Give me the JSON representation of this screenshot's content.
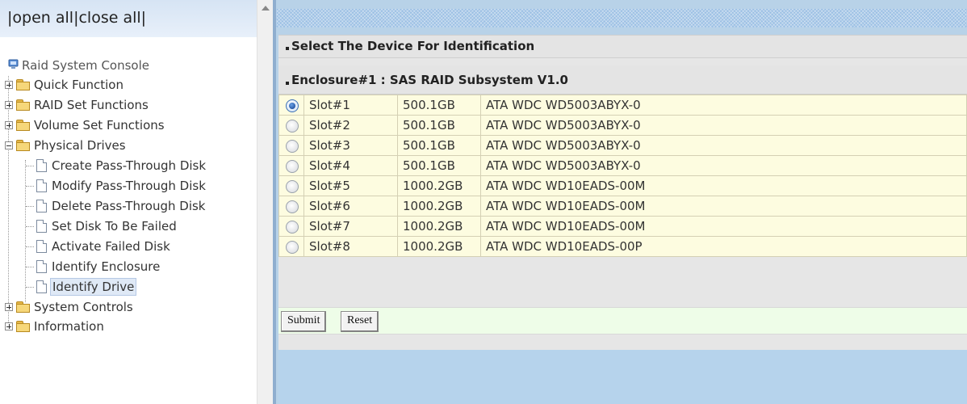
{
  "left": {
    "open_all": "open all",
    "close_all": "close all",
    "sep1": "|",
    "sep2": "|",
    "sep3": "|",
    "root": "Raid System Console",
    "items": [
      {
        "label": "Quick Function",
        "expanded": false
      },
      {
        "label": "RAID Set Functions",
        "expanded": false
      },
      {
        "label": "Volume Set Functions",
        "expanded": false
      },
      {
        "label": "Physical Drives",
        "expanded": true
      },
      {
        "label": "System Controls",
        "expanded": false
      },
      {
        "label": "Information",
        "expanded": false
      }
    ],
    "physical_drives_children": [
      "Create Pass-Through Disk",
      "Modify Pass-Through Disk",
      "Delete Pass-Through Disk",
      "Set Disk To Be Failed",
      "Activate Failed Disk",
      "Identify Enclosure",
      "Identify Drive"
    ],
    "selected_child": "Identify Drive"
  },
  "main": {
    "section_title": "Select The Device For Identification",
    "enclosure_title": "Enclosure#1 : SAS RAID Subsystem V1.0",
    "drives": [
      {
        "slot": "Slot#1",
        "capacity": "500.1GB",
        "model": "ATA WDC WD5003ABYX-0",
        "selected": true
      },
      {
        "slot": "Slot#2",
        "capacity": "500.1GB",
        "model": "ATA WDC WD5003ABYX-0",
        "selected": false
      },
      {
        "slot": "Slot#3",
        "capacity": "500.1GB",
        "model": "ATA WDC WD5003ABYX-0",
        "selected": false
      },
      {
        "slot": "Slot#4",
        "capacity": "500.1GB",
        "model": "ATA WDC WD5003ABYX-0",
        "selected": false
      },
      {
        "slot": "Slot#5",
        "capacity": "1000.2GB",
        "model": "ATA WDC WD10EADS-00M",
        "selected": false
      },
      {
        "slot": "Slot#6",
        "capacity": "1000.2GB",
        "model": "ATA WDC WD10EADS-00M",
        "selected": false
      },
      {
        "slot": "Slot#7",
        "capacity": "1000.2GB",
        "model": "ATA WDC WD10EADS-00M",
        "selected": false
      },
      {
        "slot": "Slot#8",
        "capacity": "1000.2GB",
        "model": "ATA WDC WD10EADS-00P",
        "selected": false
      }
    ],
    "submit_label": "Submit",
    "reset_label": "Reset"
  },
  "colors": {
    "row_bg": "#fdfce0",
    "button_row_bg": "#eefde8",
    "frame_blue": "#b8d2e8"
  }
}
